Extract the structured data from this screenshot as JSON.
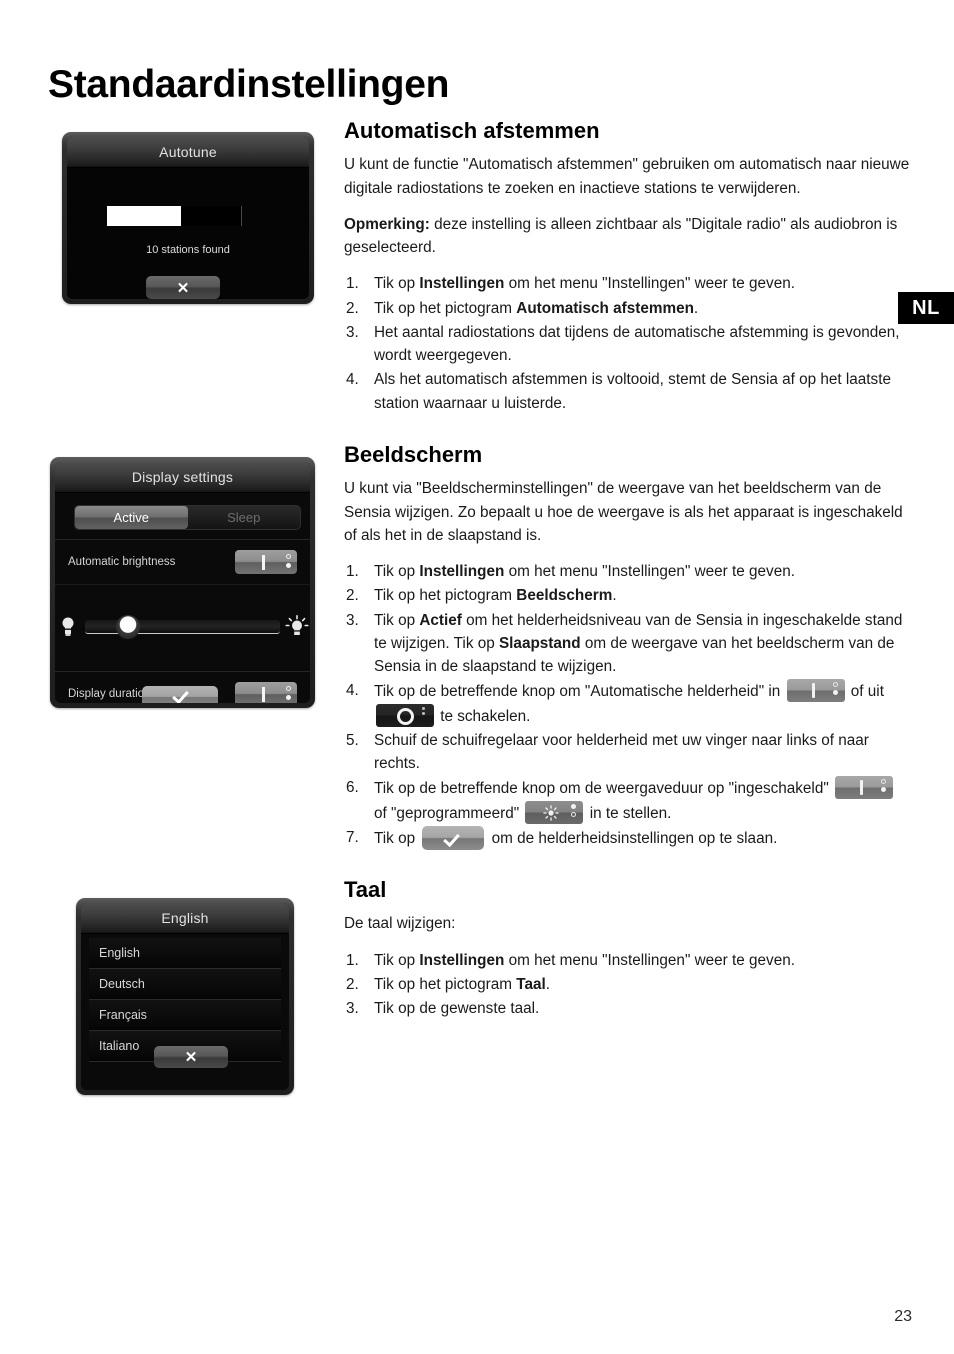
{
  "page": {
    "title": "Standaardinstellingen",
    "language_tab": "NL",
    "number": "23"
  },
  "screens": {
    "autotune": {
      "title": "Autotune",
      "status": "10 stations found",
      "progress_percent": 55,
      "close_icon": "close-x-icon",
      "close_label": "✕"
    },
    "display_settings": {
      "title": "Display settings",
      "tabs": [
        {
          "label": "Active",
          "selected": true
        },
        {
          "label": "Sleep",
          "selected": false
        }
      ],
      "rows": [
        {
          "label": "Automatic brightness",
          "control": "toggle-on"
        },
        {
          "label": "Display duration",
          "control": "toggle-on"
        }
      ],
      "slider": {
        "left_icon": "dim-bulb-icon",
        "right_icon": "bright-bulb-icon",
        "value_percent": 22
      },
      "confirm_icon": "checkmark-icon"
    },
    "language": {
      "title": "English",
      "items": [
        "English",
        "Deutsch",
        "Français",
        "Italiano"
      ],
      "close_icon": "close-x-icon",
      "close_label": "✕"
    }
  },
  "sections": [
    {
      "id": "autotune",
      "heading": "Automatisch afstemmen",
      "paragraphs": [
        {
          "runs": [
            {
              "text": "U kunt de functie \"Automatisch afstemmen\" gebruiken om automatisch naar nieuwe digitale radiostations te zoeken en inactieve stations te verwijderen.",
              "bold": false
            }
          ]
        },
        {
          "runs": [
            {
              "text": "Opmerking:",
              "bold": true
            },
            {
              "text": " deze instelling is alleen zichtbaar als \"Digitale radio\" als audiobron is geselecteerd.",
              "bold": false
            }
          ]
        }
      ],
      "steps": [
        {
          "runs": [
            {
              "text": "Tik op ",
              "bold": false
            },
            {
              "text": "Instellingen",
              "bold": true
            },
            {
              "text": " om het menu \"Instellingen\" weer te geven.",
              "bold": false
            }
          ]
        },
        {
          "runs": [
            {
              "text": "Tik op het pictogram ",
              "bold": false
            },
            {
              "text": "Automatisch afstemmen",
              "bold": true
            },
            {
              "text": ".",
              "bold": false
            }
          ]
        },
        {
          "runs": [
            {
              "text": "Het aantal radiostations dat tijdens de automatische afstemming is gevonden, wordt weergegeven.",
              "bold": false
            }
          ]
        },
        {
          "runs": [
            {
              "text": "Als het automatisch afstemmen is voltooid, stemt de Sensia af op het laatste station waarnaar u luisterde.",
              "bold": false
            }
          ]
        }
      ]
    },
    {
      "id": "beeldscherm",
      "heading": "Beeldscherm",
      "paragraphs": [
        {
          "runs": [
            {
              "text": "U kunt via \"Beeldscherminstellingen\" de weergave van het beeldscherm van de Sensia wijzigen. Zo bepaalt u hoe de weergave is als het apparaat is ingeschakeld of als het in de slaapstand is.",
              "bold": false
            }
          ]
        }
      ],
      "steps": [
        {
          "runs": [
            {
              "text": "Tik op ",
              "bold": false
            },
            {
              "text": "Instellingen",
              "bold": true
            },
            {
              "text": " om het menu \"Instellingen\" weer te geven.",
              "bold": false
            }
          ]
        },
        {
          "runs": [
            {
              "text": "Tik op het pictogram ",
              "bold": false
            },
            {
              "text": "Beeldscherm",
              "bold": true
            },
            {
              "text": ".",
              "bold": false
            }
          ]
        },
        {
          "runs": [
            {
              "text": "Tik op ",
              "bold": false
            },
            {
              "text": "Actief",
              "bold": true
            },
            {
              "text": " om het helderheidsniveau van de Sensia in ingeschakelde stand te wijzigen. Tik op ",
              "bold": false
            },
            {
              "text": "Slaapstand",
              "bold": true
            },
            {
              "text": " om de weergave van het beeldscherm van de Sensia in de slaapstand te wijzigen.",
              "bold": false
            }
          ]
        },
        {
          "runs": [
            {
              "text": "Tik op de betreffende knop om \"Automatische helderheid\" in ",
              "bold": false
            },
            {
              "icon": "toggle-on-icon"
            },
            {
              "text": " of uit ",
              "bold": false
            },
            {
              "icon": "toggle-off-icon"
            },
            {
              "text": " te schakelen.",
              "bold": false
            }
          ]
        },
        {
          "runs": [
            {
              "text": "Schuif de schuifregelaar voor helderheid met uw vinger naar links of naar rechts.",
              "bold": false
            }
          ]
        },
        {
          "runs": [
            {
              "text": "Tik op de betreffende knop om de weergaveduur op \"ingeschakeld\" ",
              "bold": false
            },
            {
              "icon": "toggle-on-icon"
            },
            {
              "text": " of \"geprogrammeerd\" ",
              "bold": false
            },
            {
              "icon": "toggle-scheduled-icon"
            },
            {
              "text": " in te stellen.",
              "bold": false
            }
          ]
        },
        {
          "runs": [
            {
              "text": "Tik op ",
              "bold": false
            },
            {
              "icon": "confirm-check-icon"
            },
            {
              "text": " om de helderheidsinstellingen op te slaan.",
              "bold": false
            }
          ]
        }
      ]
    },
    {
      "id": "taal",
      "heading": "Taal",
      "paragraphs": [
        {
          "runs": [
            {
              "text": "De taal wijzigen:",
              "bold": false
            }
          ]
        }
      ],
      "steps": [
        {
          "runs": [
            {
              "text": "Tik op ",
              "bold": false
            },
            {
              "text": "Instellingen",
              "bold": true
            },
            {
              "text": " om het menu \"Instellingen\" weer te geven.",
              "bold": false
            }
          ]
        },
        {
          "runs": [
            {
              "text": "Tik op het pictogram ",
              "bold": false
            },
            {
              "text": "Taal",
              "bold": true
            },
            {
              "text": ".",
              "bold": false
            }
          ]
        },
        {
          "runs": [
            {
              "text": "Tik op de gewenste taal.",
              "bold": false
            }
          ]
        }
      ]
    }
  ]
}
